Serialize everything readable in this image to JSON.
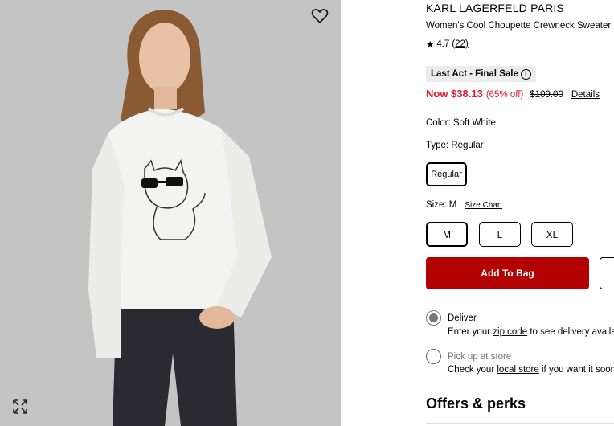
{
  "product": {
    "brand": "KARL LAGERFELD PARIS",
    "name": "Women's Cool Choupette Crewneck Sweater",
    "rating": "4.7",
    "review_count": "(22)",
    "sale_badge": "Last Act - Final Sale",
    "now_price": "Now $38.13",
    "discount": "(65% off)",
    "original_price": "$109.00",
    "details_link": "Details"
  },
  "options": {
    "color_label": "Color: Soft White",
    "type_label": "Type: Regular",
    "type_value": "Regular",
    "size_label": "Size: M",
    "size_chart": "Size Chart",
    "sizes": [
      "M",
      "L",
      "XL"
    ],
    "selected_size": "M"
  },
  "actions": {
    "add_to_bag": "Add To Bag"
  },
  "fulfillment": {
    "deliver_title": "Deliver",
    "deliver_prefix": "Enter your",
    "deliver_link": "zip code",
    "deliver_suffix": "to see delivery availab",
    "pickup_title": "Pick up at store",
    "pickup_prefix": "Check your",
    "pickup_link": "local store",
    "pickup_suffix": "if you want it soone"
  },
  "sections": {
    "offers_title": "Offers & perks"
  },
  "colors": {
    "sale_red": "#e21a2c",
    "bag_button": "#b30000",
    "photo_bg": "#c4c4c4"
  },
  "icons": {
    "favorite": "heart-icon",
    "expand": "expand-icon",
    "rating": "star-icon",
    "info": "info-icon"
  }
}
